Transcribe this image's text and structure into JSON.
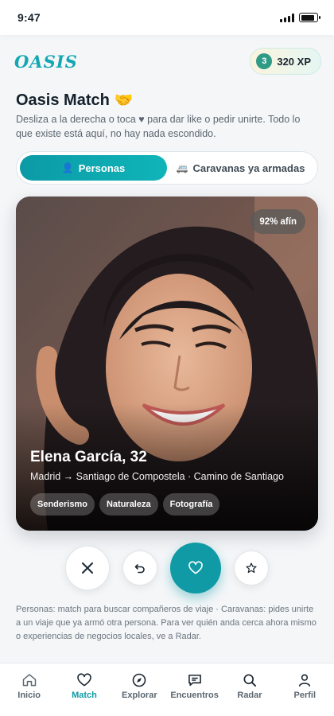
{
  "status_bar": {
    "time": "9:47"
  },
  "header": {
    "logo": "OASIS",
    "xp_level": "3",
    "xp_label": "320 XP"
  },
  "page": {
    "title": "Oasis Match",
    "subtitle": "Desliza a la derecha o toca ♥ para dar like o pedir unirte. Todo lo que existe está aquí, no hay nada escondido."
  },
  "tabs": [
    {
      "label": "Personas",
      "icon": "person-icon",
      "active": true
    },
    {
      "label": "Caravanas ya armadas",
      "icon": "van-icon",
      "active": false
    }
  ],
  "profile_card": {
    "affinity": "92% afín",
    "name_age": "Elena García, 32",
    "route": "Madrid → Santiago de Compostela · Camino de Santiago",
    "tags": [
      "Senderismo",
      "Naturaleza",
      "Fotografía"
    ]
  },
  "actions": {
    "dislike_icon": "close-icon",
    "undo_icon": "undo-icon",
    "like_icon": "heart-icon",
    "superlike_icon": "star-icon"
  },
  "footnote": "Personas: match para buscar compañeros de viaje · Caravanas: pides unirte a un viaje que ya armó otra persona. Para ver quién anda cerca ahora mismo o experiencias de negocios locales, ve a Radar.",
  "bottom_nav": [
    {
      "label": "Inicio",
      "icon": "home-icon",
      "active": false
    },
    {
      "label": "Match",
      "icon": "heart-icon",
      "active": true
    },
    {
      "label": "Explorar",
      "icon": "compass-icon",
      "active": false
    },
    {
      "label": "Encuentros",
      "icon": "chat-icon",
      "active": false
    },
    {
      "label": "Radar",
      "icon": "search-icon",
      "active": false
    },
    {
      "label": "Perfil",
      "icon": "user-icon",
      "active": false
    }
  ],
  "colors": {
    "accent": "#0f9aa5",
    "background": "#f4f6f8",
    "text": "#1b2630"
  }
}
